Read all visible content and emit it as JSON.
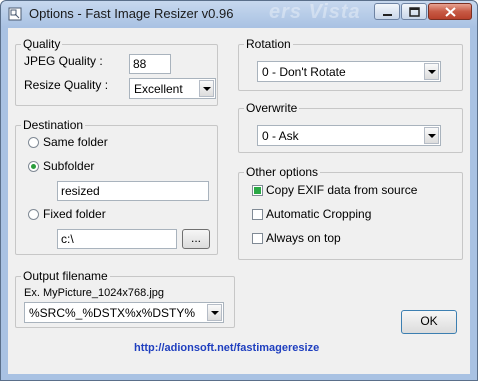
{
  "window": {
    "title": "Options - Fast Image Resizer v0.96",
    "watermark": "ers Vista"
  },
  "quality": {
    "group_label": "Quality",
    "jpeg_label": "JPEG Quality :",
    "jpeg_value": "88",
    "resize_label": "Resize Quality :",
    "resize_value": "Excellent"
  },
  "destination": {
    "group_label": "Destination",
    "same_folder_label": "Same folder",
    "subfolder_label": "Subfolder",
    "subfolder_value": "resized",
    "fixed_folder_label": "Fixed folder",
    "fixed_folder_value": "c:\\",
    "browse_label": "...",
    "selected": "subfolder"
  },
  "output": {
    "group_label": "Output filename",
    "example": "Ex. MyPicture_1024x768.jpg",
    "pattern_value": "%SRC%_%DSTX%x%DSTY%"
  },
  "rotation": {
    "group_label": "Rotation",
    "value": "0 - Don't Rotate"
  },
  "overwrite": {
    "group_label": "Overwrite",
    "value": "0 - Ask"
  },
  "other": {
    "group_label": "Other options",
    "exif_label": "Copy EXIF data from source",
    "exif_checked": true,
    "crop_label": "Automatic Cropping",
    "crop_checked": false,
    "top_label": "Always on top",
    "top_checked": false
  },
  "ok_label": "OK",
  "link_text": "http://adionsoft.net/fastimageresize",
  "colors": {
    "link": "#1f3fbf",
    "check_fill": "#2aa845",
    "radio_dot": "#2a9d3c"
  }
}
